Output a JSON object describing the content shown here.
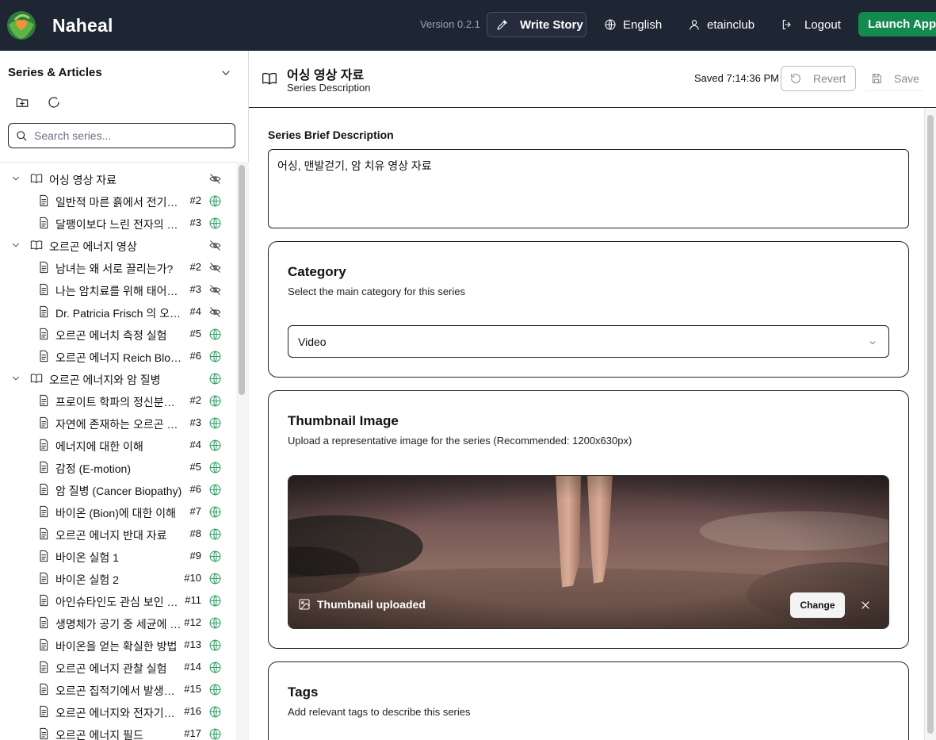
{
  "app": {
    "brand": "Naheal",
    "version": "Version 0.2.1"
  },
  "topbar": {
    "write_story": "Write Story",
    "language": "English",
    "user": "etainclub",
    "logout": "Logout",
    "launch_app": "Launch App"
  },
  "sidebar": {
    "title": "Series & Articles",
    "search_placeholder": "Search series...",
    "tree": [
      {
        "type": "series",
        "label": "어싱 영상 자료",
        "visibility": "hidden"
      },
      {
        "type": "article",
        "label": "일반적 마른 흙에서 전기가 흐르는 이유",
        "num": "#2",
        "visibility": "public"
      },
      {
        "type": "article",
        "label": "달팽이보다 느린 전자의 이동 속도",
        "num": "#3",
        "visibility": "public"
      },
      {
        "type": "series",
        "label": "오르곤 에너지 영상",
        "visibility": "hidden"
      },
      {
        "type": "article",
        "label": "남녀는 왜 서로 끌리는가?",
        "num": "#2",
        "visibility": "hidden"
      },
      {
        "type": "article",
        "label": "나는 암치료를 위해 태어났다",
        "num": "#3",
        "visibility": "hidden"
      },
      {
        "type": "article",
        "label": "Dr. Patricia Frisch 의 오르곤 에너지",
        "num": "#4",
        "visibility": "hidden"
      },
      {
        "type": "article",
        "label": "오르곤 에너치 측정 실험",
        "num": "#5",
        "visibility": "public"
      },
      {
        "type": "article",
        "label": "오르곤 에너지 Reich Blood Test",
        "num": "#6",
        "visibility": "public"
      },
      {
        "type": "series",
        "label": "오르곤 에너지와 암 질병",
        "visibility": "public"
      },
      {
        "type": "article",
        "label": "프로이트 학파의 정신분석학",
        "num": "#2",
        "visibility": "public"
      },
      {
        "type": "article",
        "label": "자연에 존재하는 오르곤 에너지",
        "num": "#3",
        "visibility": "public"
      },
      {
        "type": "article",
        "label": "에너지에 대한 이해",
        "num": "#4",
        "visibility": "public"
      },
      {
        "type": "article",
        "label": "감정 (E-motion)",
        "num": "#5",
        "visibility": "public"
      },
      {
        "type": "article",
        "label": "암 질병 (Cancer Biopathy)",
        "num": "#6",
        "visibility": "public"
      },
      {
        "type": "article",
        "label": "바이온 (Bion)에 대한 이해",
        "num": "#7",
        "visibility": "public"
      },
      {
        "type": "article",
        "label": "오르곤 에너지 반대 자료",
        "num": "#8",
        "visibility": "public"
      },
      {
        "type": "article",
        "label": "바이온 실험 1",
        "num": "#9",
        "visibility": "public"
      },
      {
        "type": "article",
        "label": "바이온 실험 2",
        "num": "#10",
        "visibility": "public"
      },
      {
        "type": "article",
        "label": "아인슈타인도 관심 보인 오르곤 에너지",
        "num": "#11",
        "visibility": "public"
      },
      {
        "type": "article",
        "label": "생명체가 공기 중 세균에 노출되는 이유",
        "num": "#12",
        "visibility": "public"
      },
      {
        "type": "article",
        "label": "바이온을 얻는 확실한 방법",
        "num": "#13",
        "visibility": "public"
      },
      {
        "type": "article",
        "label": "오르곤 에너지 관찰 실험",
        "num": "#14",
        "visibility": "public"
      },
      {
        "type": "article",
        "label": "오르곤 집적기에서 발생하는 열",
        "num": "#15",
        "visibility": "public"
      },
      {
        "type": "article",
        "label": "오르곤 에너지와 전자기장의 차이",
        "num": "#16",
        "visibility": "public"
      },
      {
        "type": "article",
        "label": "오르곤 에너지 필드",
        "num": "#17",
        "visibility": "public"
      }
    ]
  },
  "main": {
    "title": "어싱 영상 자료",
    "subtitle": "Series Description",
    "saved_status": "Saved 7:14:36 PM",
    "revert_label": "Revert",
    "save_label": "Save",
    "brief_label": "Series Brief Description",
    "brief_value": "어싱, 맨발걷기, 암 치유 영상 자료",
    "category": {
      "title": "Category",
      "description": "Select the main category for this series",
      "selected": "Video"
    },
    "thumbnail": {
      "title": "Thumbnail Image",
      "description": "Upload a representative image for the series (Recommended: 1200x630px)",
      "status": "Thumbnail uploaded",
      "change_label": "Change"
    },
    "tags": {
      "title": "Tags",
      "description": "Add relevant tags to describe this series"
    }
  },
  "colors": {
    "topbar_bg": "#1e2533",
    "accent_green": "#138a4e",
    "public_icon": "#2f9e63"
  }
}
